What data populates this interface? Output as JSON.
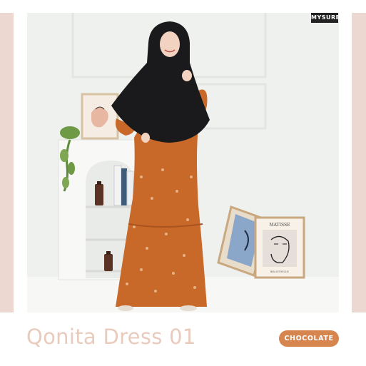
{
  "brand": {
    "logo_text": "MYSURE"
  },
  "product": {
    "name": "Qonita Dress 01",
    "variant": "CHOCOLATE"
  },
  "artwork": {
    "poster_title": "MATISSE",
    "poster_footer": "BIBLIOTHEQUE"
  },
  "colors": {
    "side_bars": "#ecd8d0",
    "backdrop": "#eef0ee",
    "title_text": "#e9cbbd",
    "variant_pill": "#d6854f",
    "dress": "#c8692a",
    "hijab": "#1a1a1c"
  }
}
